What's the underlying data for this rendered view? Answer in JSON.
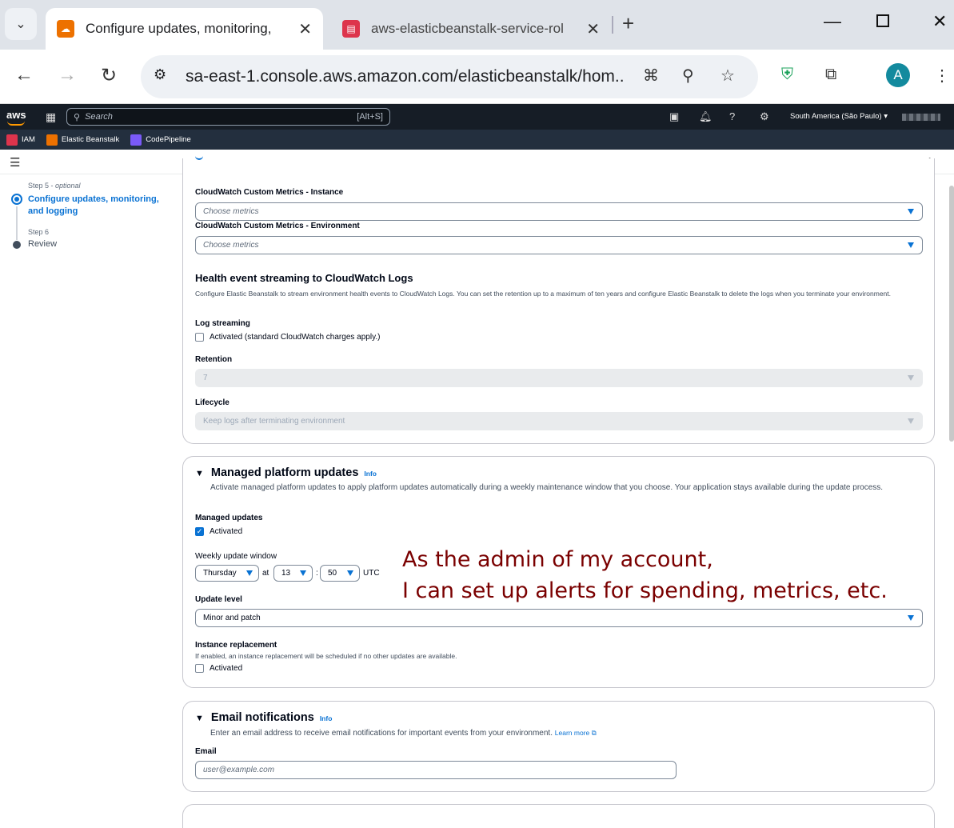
{
  "browser": {
    "tabs": [
      {
        "title": "Configure updates, monitoring,",
        "favicon": "elastic-beanstalk-favicon-icon",
        "color": "#ed7100"
      },
      {
        "title": "aws-elasticbeanstalk-service-rol",
        "favicon": "iam-favicon-icon",
        "color": "#dd344c"
      }
    ],
    "url": "sa-east-1.console.aws.amazon.com/elasticbeanstalk/hom...",
    "profile_initial": "A"
  },
  "aws_nav": {
    "logo": "aws",
    "search_placeholder": "Search",
    "search_shortcut": "[Alt+S]",
    "region": "South America (São Paulo) ▾",
    "favorites": [
      {
        "label": "IAM",
        "color": "#dd344c"
      },
      {
        "label": "Elastic Beanstalk",
        "color": "#ed7100"
      },
      {
        "label": "CodePipeline",
        "color": "#7a5af8"
      }
    ]
  },
  "steps": {
    "step5_label": "Step 5 - ",
    "step5_optional": "optional",
    "step5_title": "Configure updates, monitoring, and logging",
    "step6_label": "Step 6",
    "step6_title": "Review"
  },
  "monitoring": {
    "custom_instance_label": "CloudWatch Custom Metrics - Instance",
    "custom_instance_placeholder": "Choose metrics",
    "custom_env_label": "CloudWatch Custom Metrics - Environment",
    "custom_env_placeholder": "Choose metrics",
    "health_title": "Health event streaming to CloudWatch Logs",
    "health_desc": "Configure Elastic Beanstalk to stream environment health events to CloudWatch Logs. You can set the retention up to a maximum of ten years and configure Elastic Beanstalk to delete the logs when you terminate your environment.",
    "log_streaming_label": "Log streaming",
    "log_streaming_option": "Activated (standard CloudWatch charges apply.)",
    "retention_label": "Retention",
    "retention_value": "7",
    "lifecycle_label": "Lifecycle",
    "lifecycle_value": "Keep logs after terminating environment"
  },
  "managed_updates": {
    "title": "Managed platform updates",
    "info": "Info",
    "desc": "Activate managed platform updates to apply platform updates automatically during a weekly maintenance window that you choose. Your application stays available during the update process.",
    "managed_label": "Managed updates",
    "managed_option": "Activated",
    "window_label": "Weekly update window",
    "day": "Thursday",
    "at": "at",
    "hour": "13",
    "colon": ":",
    "minute": "50",
    "tz": "UTC",
    "level_label": "Update level",
    "level_value": "Minor and patch",
    "replacement_label": "Instance replacement",
    "replacement_desc": "If enabled, an instance replacement will be scheduled if no other updates are available.",
    "replacement_option": "Activated"
  },
  "email": {
    "title": "Email notifications",
    "info": "Info",
    "desc": "Enter an email address to receive email notifications for important events from your environment.",
    "learn_more": "Learn more",
    "label": "Email",
    "placeholder": "user@example.com"
  },
  "annotation": {
    "line1": "As the admin of my account,",
    "line2": "I can set up alerts for spending, metrics, etc."
  }
}
